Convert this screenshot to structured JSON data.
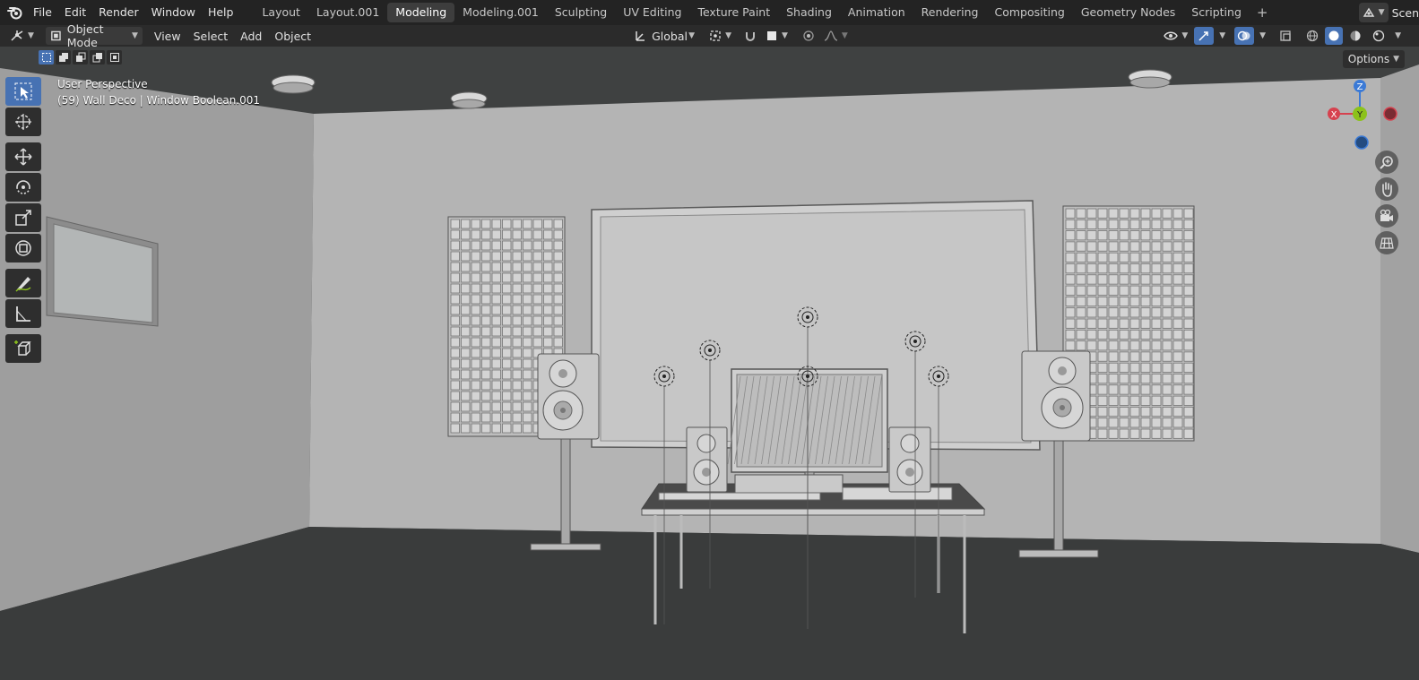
{
  "app": {
    "menus": [
      "File",
      "Edit",
      "Render",
      "Window",
      "Help"
    ]
  },
  "workspaces": {
    "tabs": [
      "Layout",
      "Layout.001",
      "Modeling",
      "Modeling.001",
      "Sculpting",
      "UV Editing",
      "Texture Paint",
      "Shading",
      "Animation",
      "Rendering",
      "Compositing",
      "Geometry Nodes",
      "Scripting"
    ],
    "active": "Modeling",
    "add_symbol": "+",
    "scene_label": "Scen"
  },
  "header": {
    "mode": "Object Mode",
    "menus": [
      "View",
      "Select",
      "Add",
      "Object"
    ],
    "transform_orientation": "Global"
  },
  "viewport": {
    "perspective": "User Perspective",
    "selection_info": "(59) Wall Deco | Window Boolean.001",
    "options_label": "Options",
    "gizmo": {
      "x": "X",
      "y": "Y",
      "z": "Z"
    }
  },
  "colors": {
    "accent": "#4772b3",
    "axis_x": "#d6424f",
    "axis_y": "#8cc21b",
    "axis_z": "#3b7ad6"
  },
  "icons": {
    "toolbar": [
      "select-box-icon",
      "cursor-icon",
      "move-icon",
      "rotate-icon",
      "scale-icon",
      "transform-icon",
      "annotate-icon",
      "measure-icon",
      "add-cube-icon"
    ],
    "nav": [
      "zoom-icon",
      "pan-hand-icon",
      "camera-icon",
      "ortho-grid-icon"
    ]
  }
}
